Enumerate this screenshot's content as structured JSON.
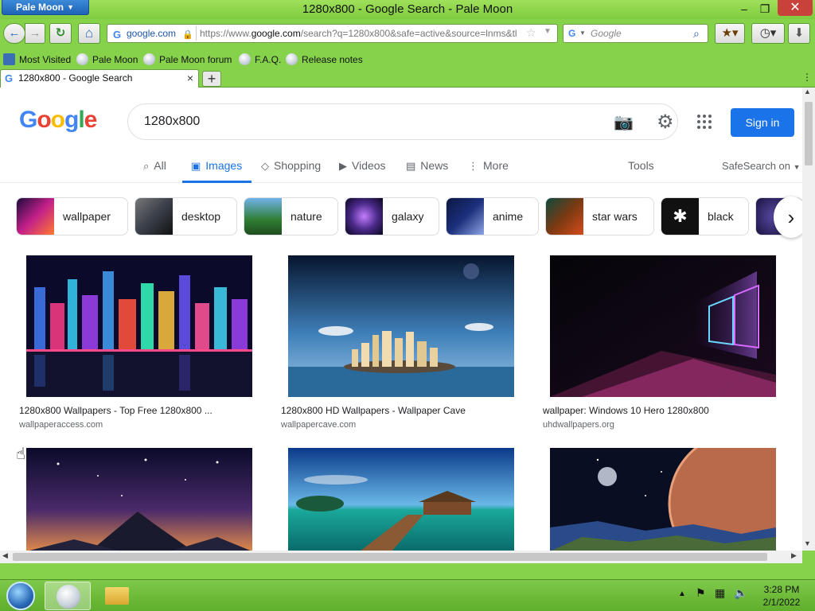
{
  "window": {
    "app_menu": "Pale Moon",
    "title": "1280x800 - Google Search - Pale Moon",
    "minimize": "–",
    "maximize": "❐",
    "close": "✕"
  },
  "toolbar": {
    "back": "←",
    "forward": "→",
    "reload": "↻",
    "home": "⌂",
    "identity": "google.com",
    "url_prefix": "https://www.",
    "url_host": "google.com",
    "url_rest": "/search?q=1280x800&safe=active&source=lnms&tl",
    "search_placeholder": "Google"
  },
  "bookmarks": [
    "Most Visited",
    "Pale Moon",
    "Pale Moon forum",
    "F.A.Q.",
    "Release notes"
  ],
  "tabs": [
    {
      "label": "1280x800 - Google Search",
      "close": "×"
    }
  ],
  "new_tab": "+",
  "google": {
    "logo": [
      "G",
      "o",
      "o",
      "g",
      "l",
      "e"
    ],
    "logo_colors": [
      "#4285f4",
      "#ea4335",
      "#fbbc05",
      "#4285f4",
      "#34a853",
      "#ea4335"
    ],
    "query": "1280x800",
    "sign_in": "Sign in",
    "nav_tabs": [
      {
        "label": "All",
        "icon": "search-icon"
      },
      {
        "label": "Images",
        "icon": "image-icon"
      },
      {
        "label": "Shopping",
        "icon": "tag-icon"
      },
      {
        "label": "Videos",
        "icon": "play-icon"
      },
      {
        "label": "News",
        "icon": "news-icon"
      },
      {
        "label": "More",
        "icon": "more-vert-icon"
      }
    ],
    "tools": "Tools",
    "safesearch": "SafeSearch on",
    "chips": [
      {
        "label": "wallpaper",
        "color": "#c21f8a"
      },
      {
        "label": "desktop",
        "color": "#3a3f4a"
      },
      {
        "label": "nature",
        "color": "#2f7d32"
      },
      {
        "label": "galaxy",
        "color": "#4b2a8a"
      },
      {
        "label": "anime",
        "color": "#1b2f7a"
      },
      {
        "label": "star wars",
        "color": "#7a3a12"
      },
      {
        "label": "black",
        "color": "#111111"
      }
    ],
    "results": [
      {
        "title": "1280x800 Wallpapers - Top Free 1280x800 ...",
        "source": "wallpaperaccess.com"
      },
      {
        "title": "1280x800 HD Wallpapers - Wallpaper Cave",
        "source": "wallpapercave.com"
      },
      {
        "title": "wallpaper: Windows 10 Hero 1280x800",
        "source": "uhdwallpapers.org"
      },
      {
        "title": "",
        "source": ""
      },
      {
        "title": "",
        "source": ""
      },
      {
        "title": "",
        "source": ""
      }
    ]
  },
  "taskbar": {
    "time": "3:28 PM",
    "date": "2/1/2022"
  }
}
